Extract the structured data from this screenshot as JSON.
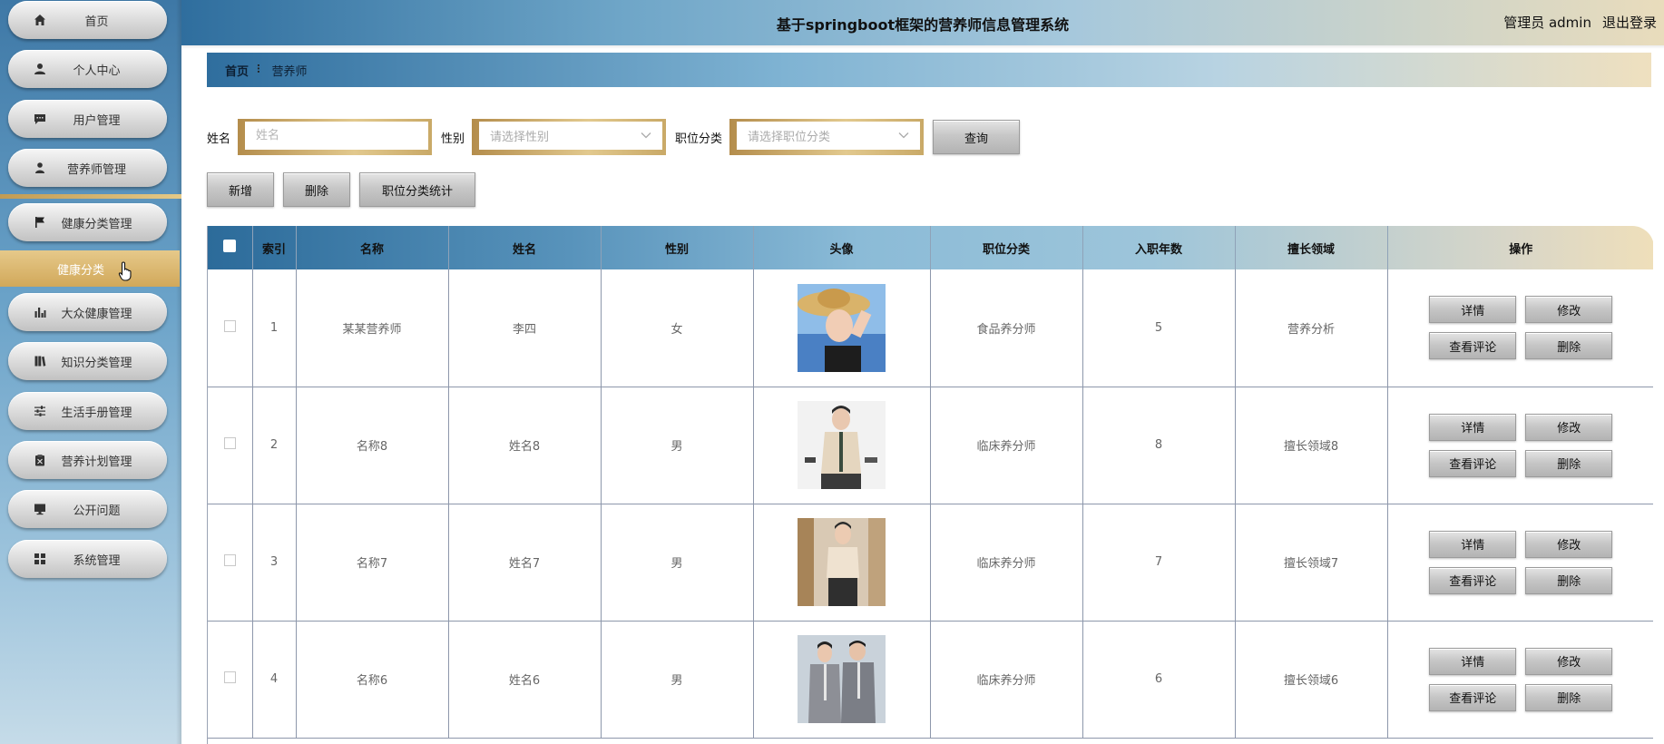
{
  "header": {
    "title": "基于springboot框架的营养师信息管理系统",
    "user_label": "管理员 admin",
    "logout_label": "退出登录"
  },
  "sidebar": {
    "items": [
      {
        "label": "首页",
        "icon": "home-icon"
      },
      {
        "label": "个人中心",
        "icon": "user-icon"
      },
      {
        "label": "用户管理",
        "icon": "chat-icon"
      },
      {
        "label": "营养师管理",
        "icon": "person-icon"
      },
      {
        "label": "健康分类管理",
        "icon": "flag-icon"
      },
      {
        "label": "大众健康管理",
        "icon": "bar-chart-icon"
      },
      {
        "label": "知识分类管理",
        "icon": "book-icon"
      },
      {
        "label": "生活手册管理",
        "icon": "sliders-icon"
      },
      {
        "label": "营养计划管理",
        "icon": "clipboard-icon"
      },
      {
        "label": "公开问题",
        "icon": "monitor-icon"
      },
      {
        "label": "系统管理",
        "icon": "grid-icon"
      }
    ],
    "sub_item": "健康分类"
  },
  "breadcrumb": {
    "home": "首页",
    "separator": "⠇",
    "current": "营养师"
  },
  "search": {
    "name_label": "姓名",
    "name_placeholder": "姓名",
    "gender_label": "性别",
    "gender_placeholder": "请选择性别",
    "category_label": "职位分类",
    "category_placeholder": "请选择职位分类",
    "query_button": "查询"
  },
  "actions": {
    "add": "新增",
    "delete": "删除",
    "stats": "职位分类统计"
  },
  "table": {
    "headers": [
      "索引",
      "名称",
      "姓名",
      "性别",
      "头像",
      "职位分类",
      "入职年数",
      "擅长领域",
      "操作"
    ],
    "rows": [
      {
        "index": "1",
        "title": "某某营养师",
        "name": "李四",
        "gender": "女",
        "category": "食品养分师",
        "years": "5",
        "field": "营养分析"
      },
      {
        "index": "2",
        "title": "名称8",
        "name": "姓名8",
        "gender": "男",
        "category": "临床养分师",
        "years": "8",
        "field": "擅长领域8"
      },
      {
        "index": "3",
        "title": "名称7",
        "name": "姓名7",
        "gender": "男",
        "category": "临床养分师",
        "years": "7",
        "field": "擅长领域7"
      },
      {
        "index": "4",
        "title": "名称6",
        "name": "姓名6",
        "gender": "男",
        "category": "临床养分师",
        "years": "6",
        "field": "擅长领域6"
      }
    ],
    "row_actions": {
      "detail": "详情",
      "edit": "修改",
      "comments": "查看评论",
      "delete": "删除"
    }
  },
  "colors": {
    "header_blue": "#2f6e9e",
    "gold_accent": "#d1a85a",
    "button_grey": "#c7c7c7"
  }
}
